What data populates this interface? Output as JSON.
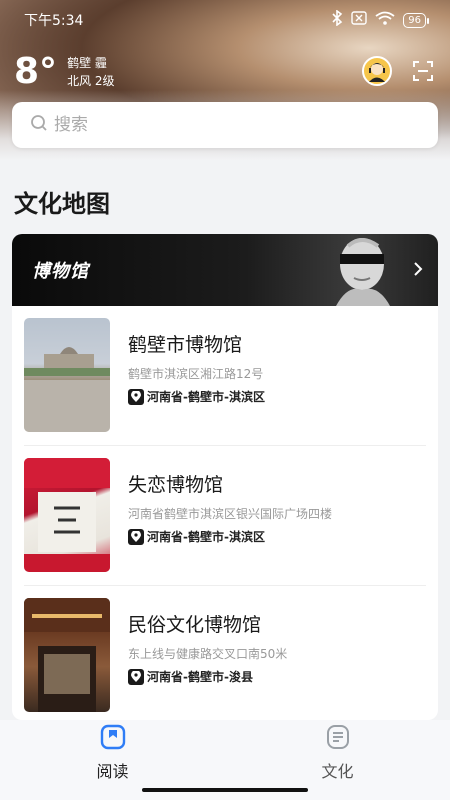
{
  "status_bar": {
    "time": "下午5:34",
    "battery": "96"
  },
  "weather": {
    "temperature": "8°",
    "city": "鹤壁 霾",
    "wind": "北风 2级"
  },
  "search": {
    "placeholder": "搜索"
  },
  "section": {
    "title": "文化地图"
  },
  "banner": {
    "title": "博物馆"
  },
  "museums": [
    {
      "name": "鹤壁市博物馆",
      "address": "鹤壁市淇滨区湘江路12号",
      "region": "河南省-鹤壁市-淇滨区"
    },
    {
      "name": "失恋博物馆",
      "address": "河南省鹤壁市淇滨区银兴国际广场四楼",
      "region": "河南省-鹤壁市-淇滨区"
    },
    {
      "name": "民俗文化博物馆",
      "address": "东上线与健康路交叉口南50米",
      "region": "河南省-鹤壁市-浚县"
    }
  ],
  "tabs": [
    {
      "label": "阅读",
      "icon": "bookmark-icon",
      "active": true
    },
    {
      "label": "文化",
      "icon": "document-icon",
      "active": false
    }
  ],
  "colors": {
    "accent": "#2f7df6",
    "banner_bg": "#0a0a0a"
  }
}
